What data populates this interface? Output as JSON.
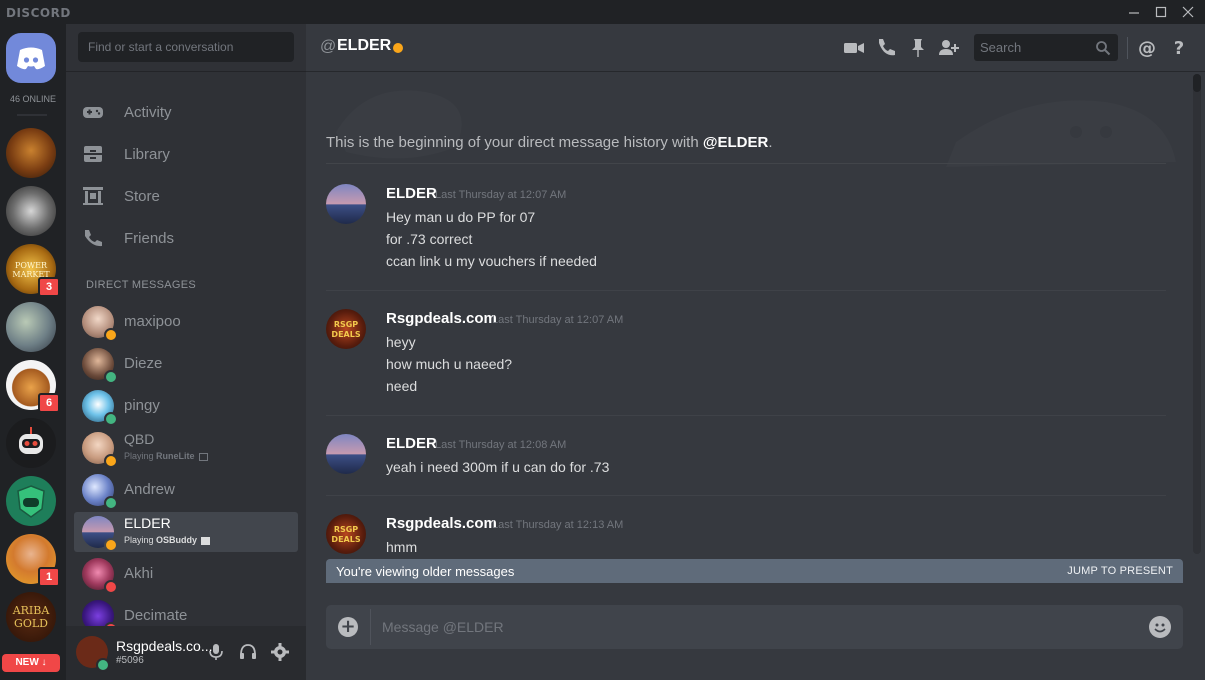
{
  "window": {
    "brand": "DISCORD",
    "controls": [
      "minimize-icon",
      "maximize-icon",
      "close-icon"
    ]
  },
  "rail": {
    "online_text": "46 ONLINE",
    "guilds": [
      {
        "name": "lion-server",
        "badge": ""
      },
      {
        "name": "skull-server",
        "badge": ""
      },
      {
        "name": "power-market",
        "badge": "3"
      },
      {
        "name": "art-server",
        "badge": ""
      },
      {
        "name": "house-server",
        "badge": "6"
      },
      {
        "name": "robot-server",
        "badge": ""
      },
      {
        "name": "shield-server",
        "badge": ""
      },
      {
        "name": "person-server",
        "badge": "1"
      },
      {
        "name": "ariba-gold",
        "badge": ""
      }
    ],
    "new_label": "NEW ↓"
  },
  "sidebar": {
    "search_placeholder": "Find or start a conversation",
    "nav": [
      {
        "label": "Activity",
        "icon": "gamepad-icon"
      },
      {
        "label": "Library",
        "icon": "library-icon"
      },
      {
        "label": "Store",
        "icon": "store-icon"
      },
      {
        "label": "Friends",
        "icon": "friends-icon"
      }
    ],
    "dm_header": "DIRECT MESSAGES",
    "dms": [
      {
        "name": "maxipoo",
        "status": "idle",
        "sub": "",
        "game": ""
      },
      {
        "name": "Dieze",
        "status": "online",
        "sub": "",
        "game": ""
      },
      {
        "name": "pingy",
        "status": "online",
        "sub": "",
        "game": ""
      },
      {
        "name": "QBD",
        "status": "idle",
        "sub": "Playing ",
        "game": "RuneLite"
      },
      {
        "name": "Andrew",
        "status": "online",
        "sub": "",
        "game": ""
      },
      {
        "name": "ELDER",
        "status": "idle",
        "sub": "Playing ",
        "game": "OSBuddy",
        "active": true
      },
      {
        "name": "Akhi",
        "status": "dnd",
        "sub": "",
        "game": ""
      },
      {
        "name": "Decimate",
        "status": "dnd",
        "sub": "",
        "game": ""
      }
    ],
    "user": {
      "name": "Rsgpdeals.co...",
      "tag": "#5096"
    }
  },
  "chat": {
    "at": "@",
    "channel_name": "ELDER",
    "search_placeholder": "Search",
    "welcome_prefix": "This is the beginning of your direct message history with ",
    "welcome_name": "@ELDER",
    "welcome_suffix": ".",
    "messages": [
      {
        "author": "ELDER",
        "time": "Last Thursday at 12:07 AM",
        "lines": [
          "Hey man u do PP for 07",
          "for .73 correct",
          "ccan link u my vouchers if needed"
        ]
      },
      {
        "author": "Rsgpdeals.com",
        "time": "Last Thursday at 12:07 AM",
        "lines": [
          "heyy",
          "how much u naeed?",
          "need"
        ]
      },
      {
        "author": "ELDER",
        "time": "Last Thursday at 12:08 AM",
        "lines": [
          "yeah i need 300m if u can do for .73"
        ]
      },
      {
        "author": "Rsgpdeals.com",
        "time": "Last Thursday at 12:13 AM",
        "lines": [
          "hmm"
        ]
      }
    ],
    "older_text": "You're viewing older messages",
    "jump_label": "JUMP TO PRESENT",
    "composer_placeholder": "Message @ELDER"
  },
  "colors": {
    "blurple": "#7289da",
    "idle": "#faa61a",
    "online": "#43b581",
    "dnd": "#f04747"
  }
}
